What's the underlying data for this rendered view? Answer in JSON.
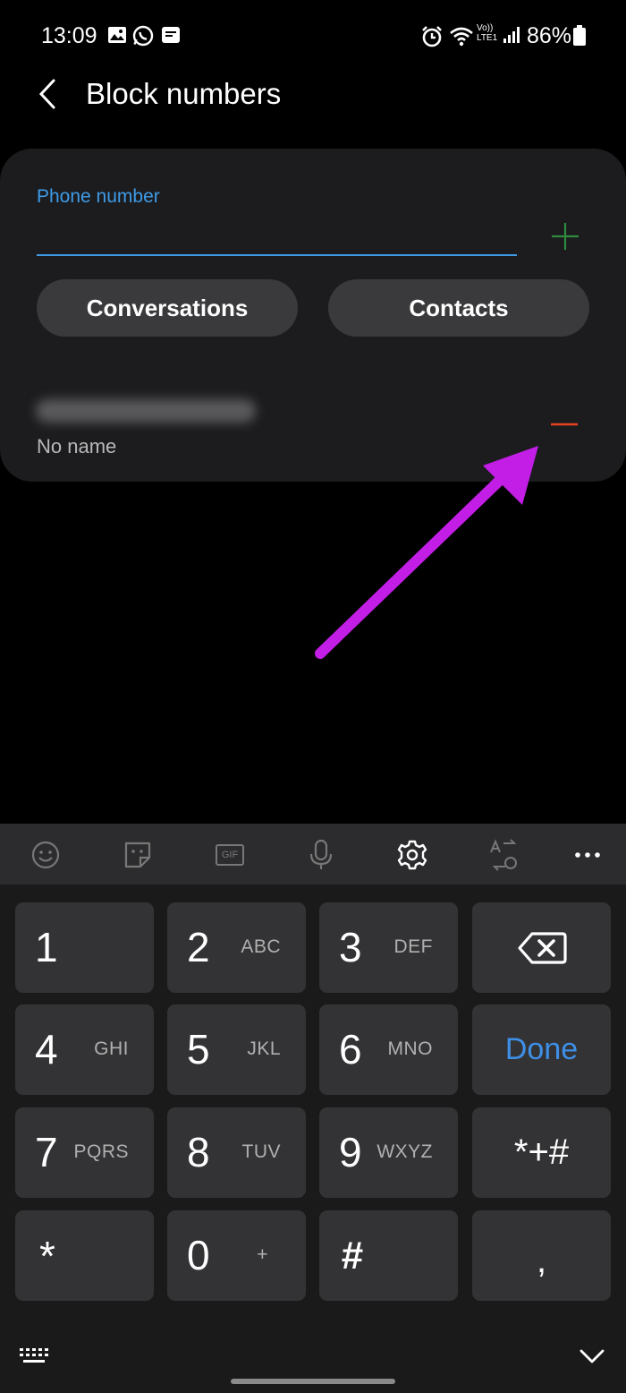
{
  "status_bar": {
    "time": "13:09",
    "battery": "86%",
    "lte_label": "LTE1",
    "volte_label": "Vo))"
  },
  "header": {
    "title": "Block numbers"
  },
  "form": {
    "phone_label": "Phone number",
    "conversations_button": "Conversations",
    "contacts_button": "Contacts"
  },
  "blocked_list": [
    {
      "name": "No name"
    }
  ],
  "colors": {
    "accent": "#3e9be8",
    "add": "#2e8b3e",
    "remove": "#e8431f",
    "annotation": "#c21ee6"
  },
  "keyboard": {
    "toolbar": [
      "emoji-icon",
      "sticker-icon",
      "gif-icon",
      "mic-icon",
      "gear-icon",
      "translate-icon",
      "more-icon"
    ],
    "gif_label": "GIF",
    "rows": [
      [
        {
          "digit": "1",
          "letters": ""
        },
        {
          "digit": "2",
          "letters": "ABC"
        },
        {
          "digit": "3",
          "letters": "DEF"
        },
        {
          "digit": "",
          "letters": "",
          "icon": "backspace-icon"
        }
      ],
      [
        {
          "digit": "4",
          "letters": "GHI"
        },
        {
          "digit": "5",
          "letters": "JKL"
        },
        {
          "digit": "6",
          "letters": "MNO"
        },
        {
          "digit": "Done",
          "letters": ""
        }
      ],
      [
        {
          "digit": "7",
          "letters": "PQRS"
        },
        {
          "digit": "8",
          "letters": "TUV"
        },
        {
          "digit": "9",
          "letters": "WXYZ"
        },
        {
          "digit": "*+#",
          "letters": ""
        }
      ],
      [
        {
          "digit": "*",
          "letters": ""
        },
        {
          "digit": "0",
          "letters": "+"
        },
        {
          "digit": "#",
          "letters": ""
        },
        {
          "digit": ",",
          "letters": ""
        }
      ]
    ]
  }
}
